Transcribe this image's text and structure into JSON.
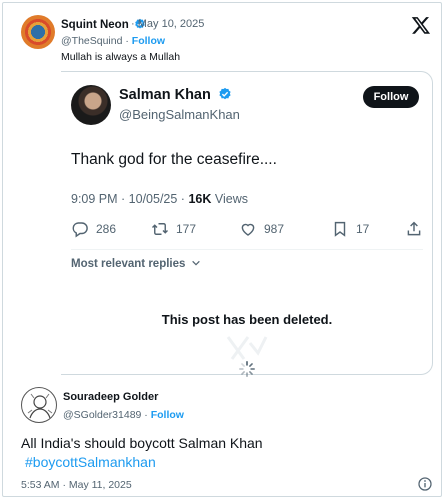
{
  "post": {
    "author_name": "Squint Neon",
    "verified": true,
    "date": "May 10, 2025",
    "handle": "@TheSquind",
    "follow_label": "Follow",
    "text": "Mullah is always a Mullah"
  },
  "quoted": {
    "author_name": "Salman Khan",
    "verified": true,
    "handle": "@BeingSalmanKhan",
    "follow_button": "Follow",
    "text": "Thank god for the ceasefire....",
    "time": "9:09 PM · 10/05/25 · ",
    "views_count": "16K",
    "views_label": " Views",
    "replies": "286",
    "reposts": "177",
    "likes": "987",
    "bookmarks": "17",
    "relevant_replies": "Most relevant replies",
    "deleted_notice": "This post has been deleted."
  },
  "reply": {
    "author_name": "Souradeep Golder",
    "handle": "@SGolder31489",
    "follow_label": "Follow",
    "text": "All India's should boycott Salman Khan",
    "hashtag": "#boycottSalmankhan",
    "timestamp": "5:53 AM · May 11, 2025"
  },
  "colors": {
    "accent": "#1d9bf0",
    "text": "#0f1419",
    "muted": "#536471"
  }
}
